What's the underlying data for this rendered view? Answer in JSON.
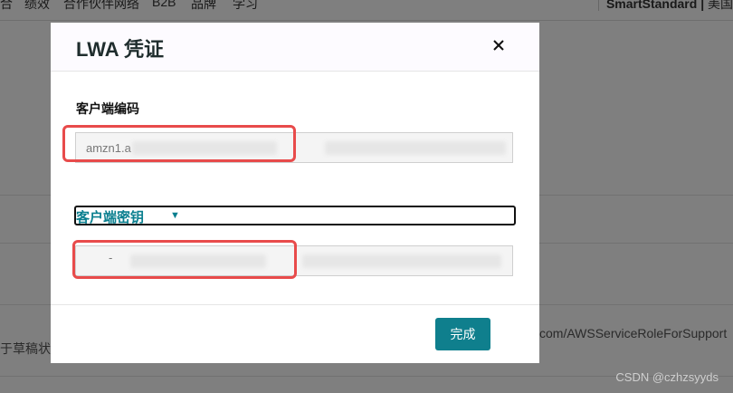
{
  "background": {
    "nav_items": [
      "合",
      "绩效",
      "合作伙伴网络",
      "B2B",
      "品牌",
      "学习"
    ],
    "brand": "SmartStandard",
    "region": "美国",
    "left_text": "于草稿状",
    "right_text": "com/AWSServiceRoleForSupport"
  },
  "modal": {
    "title": "LWA 凭证",
    "close_symbol": "×",
    "client_id_label": "客户端编码",
    "client_id_value": "amzn1.a",
    "client_secret_label": "客户端密钥",
    "client_secret_caret": "▼",
    "client_secret_value": "-",
    "done_label": "完成"
  },
  "watermark": "CSDN @czhzsyyds",
  "colors": {
    "accent": "#0f7f8d",
    "highlight": "#e84b4b",
    "overlay": "rgba(0,0,0,0.5)"
  }
}
